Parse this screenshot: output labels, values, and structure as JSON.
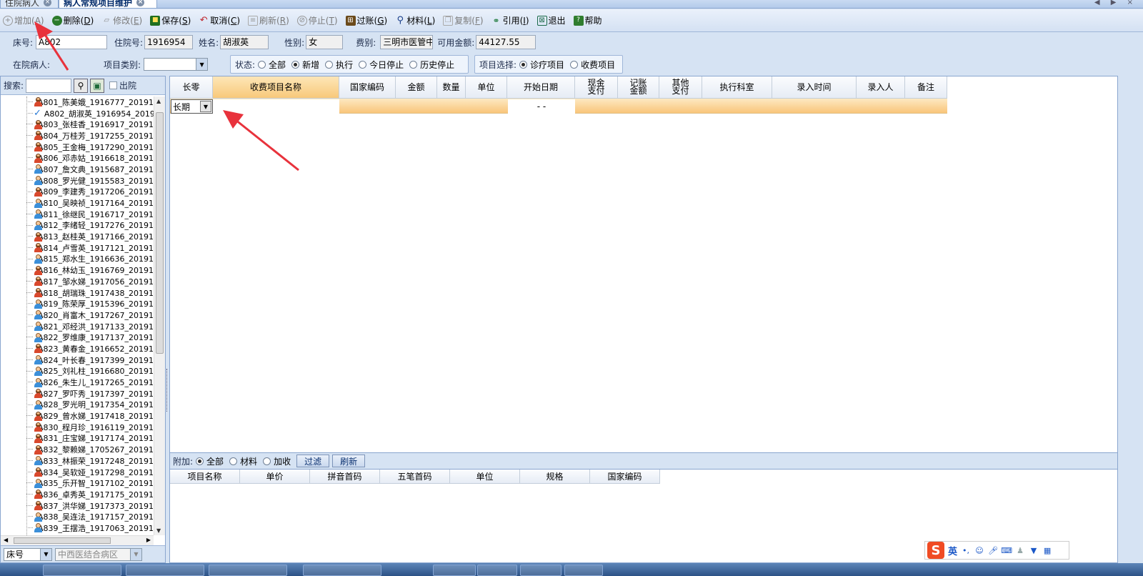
{
  "tabs": [
    {
      "label": "住院病人"
    },
    {
      "label": "病人常规项目维护"
    }
  ],
  "toolbar": {
    "buttons": [
      {
        "label": "增加",
        "key": "A",
        "icon": "add-icon",
        "enabled": false
      },
      {
        "label": "删除",
        "key": "D",
        "icon": "delete-icon",
        "enabled": true
      },
      {
        "label": "修改",
        "key": "E",
        "icon": "edit-icon",
        "enabled": false
      },
      {
        "label": "保存",
        "key": "S",
        "icon": "save-icon",
        "enabled": true
      },
      {
        "label": "取消",
        "key": "C",
        "icon": "undo-icon",
        "enabled": true
      },
      {
        "label": "刷新",
        "key": "R",
        "icon": "refresh-icon",
        "enabled": false
      },
      {
        "label": "停止",
        "key": "T",
        "icon": "stop-icon",
        "enabled": false
      },
      {
        "label": "过账",
        "key": "G",
        "icon": "post-icon",
        "enabled": true
      },
      {
        "label": "材料",
        "key": "L",
        "icon": "search-icon",
        "enabled": true
      },
      {
        "label": "复制",
        "key": "F",
        "icon": "copy-icon",
        "enabled": false
      },
      {
        "label": "引用",
        "key": "I",
        "icon": "binoculars-icon",
        "enabled": true
      },
      {
        "label": "退出",
        "key": "",
        "icon": "exit-icon",
        "enabled": true
      },
      {
        "label": "帮助",
        "key": "",
        "icon": "help-icon",
        "enabled": true
      }
    ]
  },
  "patient": {
    "bed_label": "床号:",
    "bed_value": "A802",
    "admission_no_label": "住院号:",
    "admission_no_value": "1916954",
    "name_label": "姓名:",
    "name_value": "胡淑英",
    "gender_label": "性别:",
    "gender_value": "女",
    "fee_type_label": "费别:",
    "fee_type_value": "三明市医管中",
    "balance_label": "可用金额:",
    "balance_value": "44127.55",
    "inpatient_label": "在院病人:",
    "item_category_label": "项目类别:",
    "item_category_value": ""
  },
  "status_filter": {
    "label": "状态:",
    "options": [
      "全部",
      "新增",
      "执行",
      "今日停止",
      "历史停止"
    ],
    "selected": "新增"
  },
  "item_select": {
    "label": "项目选择:",
    "options": [
      "诊疗项目",
      "收费项目"
    ],
    "selected": "诊疗项目"
  },
  "search": {
    "label": "搜索:",
    "value": "",
    "discharge_label": "出院"
  },
  "patients": [
    {
      "text": "A801_陈美娥_1916777_20191",
      "g": "f"
    },
    {
      "text": "A802_胡淑英_1916954_20191",
      "g": "check"
    },
    {
      "text": "A803_张桂香_1916917_20191",
      "g": "f"
    },
    {
      "text": "A804_万桂芳_1917255_20191",
      "g": "f"
    },
    {
      "text": "A805_王金梅_1917290_20191",
      "g": "f"
    },
    {
      "text": "A806_邓赤姑_1916618_20191",
      "g": "f"
    },
    {
      "text": "A807_詹文典_1915687_20191",
      "g": "m"
    },
    {
      "text": "A808_罗光健_1915583_20191",
      "g": "m"
    },
    {
      "text": "A809_李建秀_1917206_20191",
      "g": "f"
    },
    {
      "text": "A810_吴映祯_1917164_20191",
      "g": "m"
    },
    {
      "text": "A811_徐继民_1916717_20191",
      "g": "m"
    },
    {
      "text": "A812_李绪轻_1917276_20191",
      "g": "m"
    },
    {
      "text": "A813_赵桂英_1917166_20191",
      "g": "f"
    },
    {
      "text": "A814_卢雪英_1917121_20191",
      "g": "f"
    },
    {
      "text": "A815_郑水生_1916636_20191",
      "g": "m"
    },
    {
      "text": "A816_林幼玉_1916769_20191",
      "g": "f"
    },
    {
      "text": "A817_邹水娣_1917056_20191",
      "g": "f"
    },
    {
      "text": "A818_胡瑞珠_1917438_20191",
      "g": "f"
    },
    {
      "text": "A819_陈荣厚_1915396_20191",
      "g": "m"
    },
    {
      "text": "A820_肖富木_1917267_20191",
      "g": "m"
    },
    {
      "text": "A821_邓经洪_1917133_20191",
      "g": "m"
    },
    {
      "text": "A822_罗维康_1917137_20191",
      "g": "m"
    },
    {
      "text": "A823_黄春金_1916652_20191",
      "g": "f"
    },
    {
      "text": "A824_叶长春_1917399_20191",
      "g": "m"
    },
    {
      "text": "A825_刘礼柱_1916680_20191",
      "g": "m"
    },
    {
      "text": "A826_朱生儿_1917265_20191",
      "g": "m"
    },
    {
      "text": "A827_罗吓秀_1917397_20191",
      "g": "f"
    },
    {
      "text": "A828_罗光明_1917354_20191",
      "g": "m"
    },
    {
      "text": "A829_曾水娣_1917418_20191",
      "g": "f"
    },
    {
      "text": "A830_程月珍_1916119_20191",
      "g": "f"
    },
    {
      "text": "A831_庄宝娣_1917174_20191",
      "g": "f"
    },
    {
      "text": "A832_黎赖娣_1705267_20191",
      "g": "f"
    },
    {
      "text": "A833_林振荣_1917248_20191",
      "g": "m"
    },
    {
      "text": "A834_吴软娅_1917298_20191",
      "g": "f"
    },
    {
      "text": "A835_乐开智_1917102_20191",
      "g": "m"
    },
    {
      "text": "A836_卓秀英_1917175_20191",
      "g": "f"
    },
    {
      "text": "A837_洪华娣_1917373_20191",
      "g": "f"
    },
    {
      "text": "A838_吴连法_1917157_20191",
      "g": "m"
    },
    {
      "text": "A839_王摆浩_1917063_20191",
      "g": "m"
    }
  ],
  "bottom_left": {
    "sort_value": "床号",
    "ward_value": "中西医结合病区"
  },
  "grid": {
    "columns": [
      "长零",
      "收费项目名称",
      "国家编码",
      "金额",
      "数量",
      "单位",
      "开始日期",
      "现金\n支付",
      "记账\n金额",
      "其他\n支付",
      "执行科室",
      "录入时间",
      "录入人",
      "备注"
    ],
    "new_row": {
      "type_value": "长期",
      "start_date": "-    -"
    }
  },
  "addon": {
    "label": "附加:",
    "options": [
      "全部",
      "材料",
      "加收"
    ],
    "selected": "全部",
    "filter_label": "过滤",
    "refresh_label": "刷新"
  },
  "grid2": {
    "columns": [
      "项目名称",
      "单价",
      "拼音首码",
      "五笔首码",
      "单位",
      "规格",
      "国家编码"
    ]
  },
  "ime": {
    "logo": "S",
    "mode": "英",
    "punct": "•,"
  },
  "colors": {
    "selected_row": "#f9c57a",
    "annotation_arrow": "#e8323c",
    "toolbar_bg": "#d4e1f3"
  }
}
